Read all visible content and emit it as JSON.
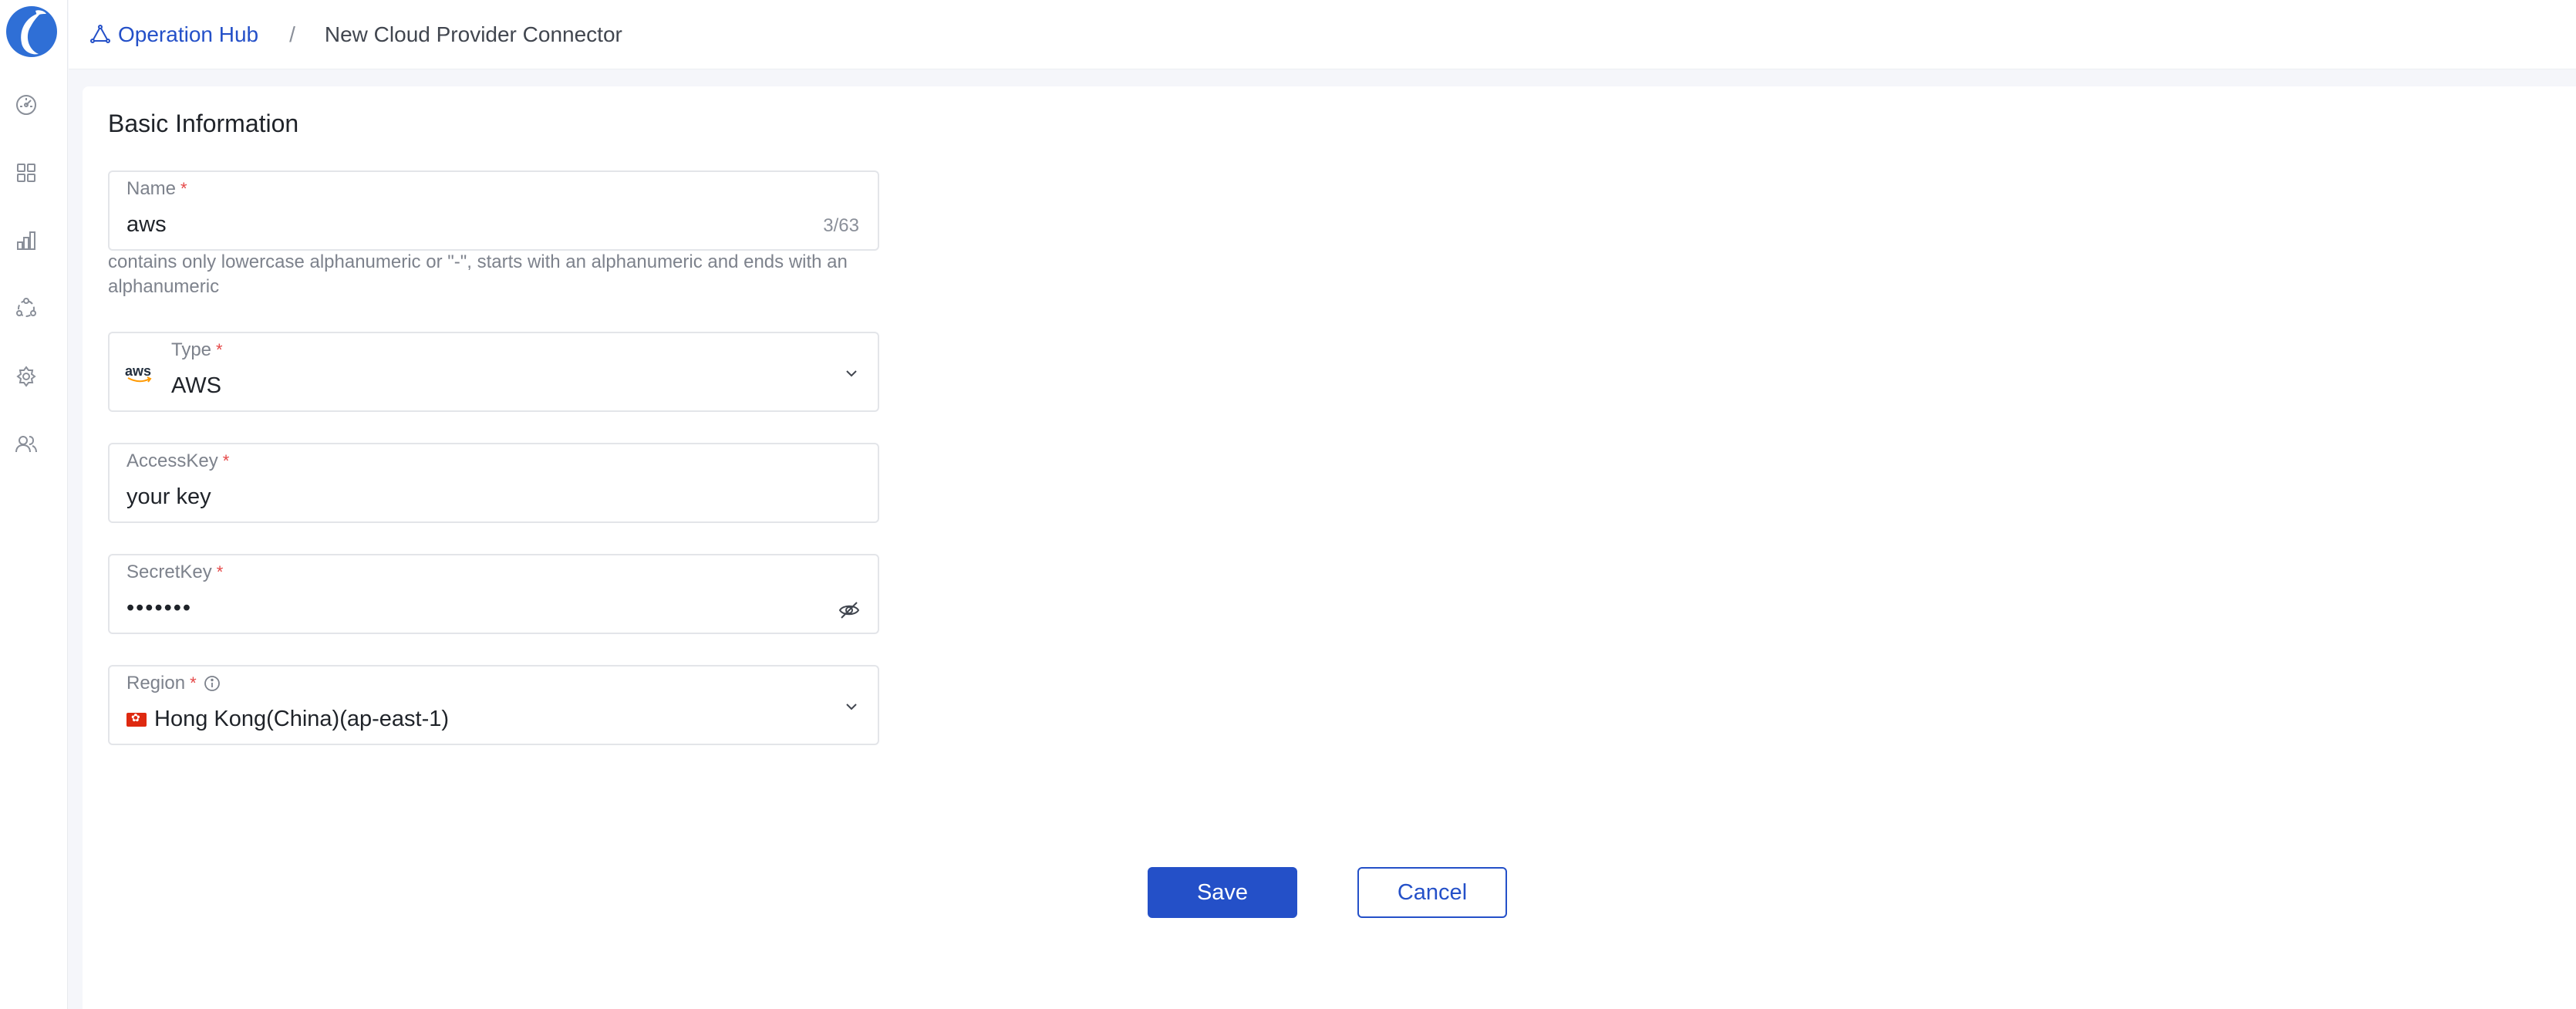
{
  "breadcrumb": {
    "hub_label": "Operation Hub",
    "separator": "/",
    "current": "New Cloud Provider Connector"
  },
  "sidebar": {
    "items": [
      {
        "name": "dashboard-icon"
      },
      {
        "name": "apps-grid-icon"
      },
      {
        "name": "chart-icon"
      },
      {
        "name": "network-icon"
      },
      {
        "name": "settings-icon"
      },
      {
        "name": "users-icon"
      }
    ]
  },
  "form": {
    "section_title": "Basic Information",
    "required_mark": "*",
    "name": {
      "label": "Name",
      "value": "aws",
      "counter": "3/63",
      "hint": "contains only lowercase alphanumeric or \"-\", starts with an alphanumeric and ends with an alphanumeric"
    },
    "type": {
      "label": "Type",
      "value": "AWS",
      "logo_text": "aws"
    },
    "access_key": {
      "label": "AccessKey",
      "value": "your key"
    },
    "secret_key": {
      "label": "SecretKey",
      "value": "•••••••"
    },
    "region": {
      "label": "Region",
      "value": "Hong Kong(China)(ap-east-1)"
    }
  },
  "actions": {
    "save_label": "Save",
    "cancel_label": "Cancel"
  },
  "colors": {
    "accent": "#2450c8",
    "required": "#e54848",
    "page_bg": "#f5f6fa"
  }
}
